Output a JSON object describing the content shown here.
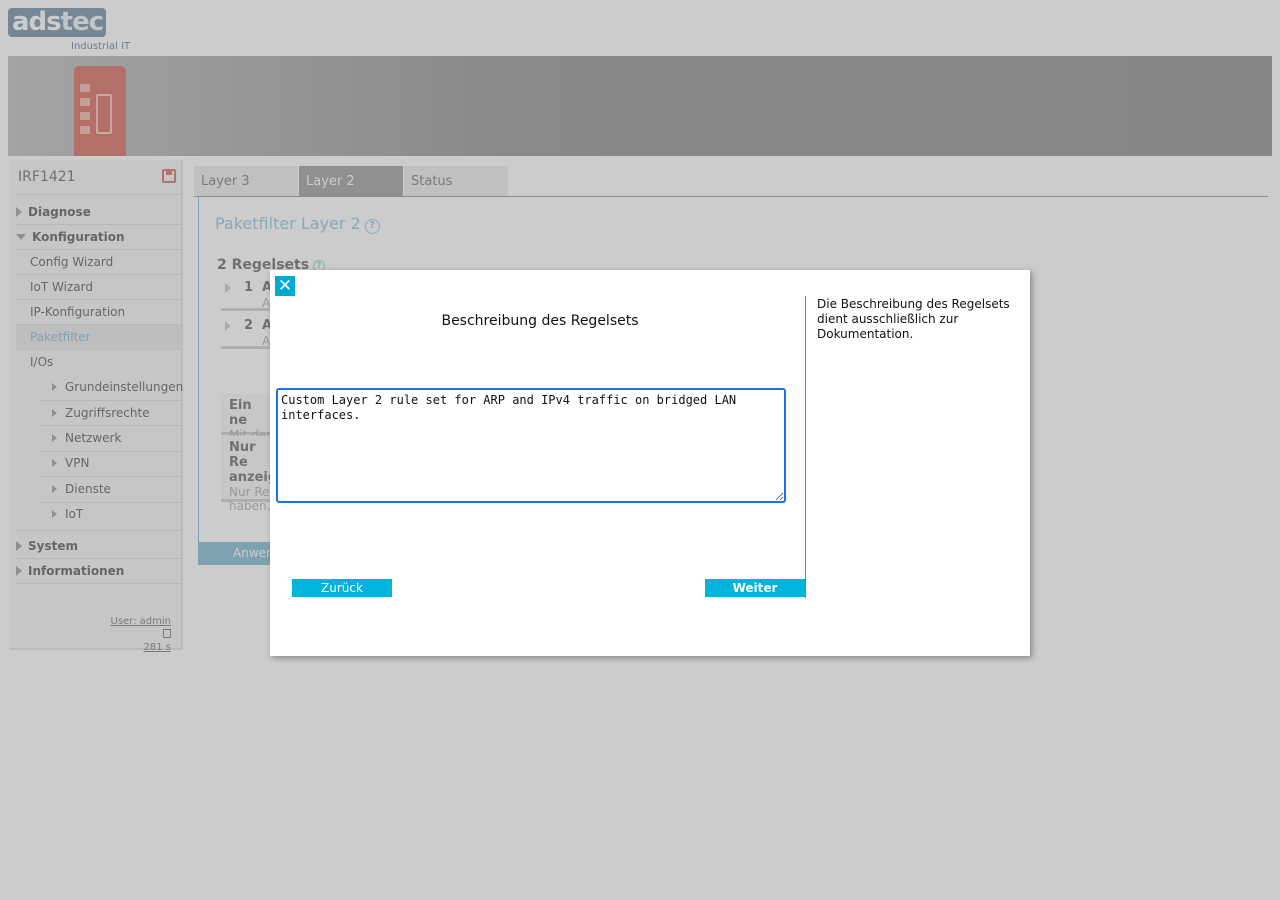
{
  "brand": {
    "logo_main": "ads",
    "logo_accent": "tec",
    "logo_subtitle": "Industrial IT"
  },
  "sidebar": {
    "device_name": "IRF1421",
    "items": [
      {
        "label": "Diagnose"
      },
      {
        "label": "Konfiguration"
      },
      {
        "label": "Config Wizard"
      },
      {
        "label": "IoT Wizard"
      },
      {
        "label": "IP-Konfiguration"
      },
      {
        "label": "Paketfilter"
      },
      {
        "label": "I/Os"
      },
      {
        "label": "Grundeinstellungen"
      },
      {
        "label": "Zugriffsrechte"
      },
      {
        "label": "Netzwerk"
      },
      {
        "label": "VPN"
      },
      {
        "label": "Dienste"
      },
      {
        "label": "IoT"
      },
      {
        "label": "System"
      },
      {
        "label": "Informationen"
      }
    ],
    "user_label": "User: admin",
    "session_time": "281 s"
  },
  "tabs": [
    {
      "label": "Layer 3"
    },
    {
      "label": "Layer 2"
    },
    {
      "label": "Status"
    }
  ],
  "main": {
    "page_title": "Paketfilter Layer 2",
    "help_glyph": "?",
    "rulesets_title": "2 Regelsets",
    "rules": [
      {
        "num": "1",
        "name": "A",
        "desc": "A"
      },
      {
        "num": "2",
        "name": "A",
        "desc": "A"
      }
    ],
    "info1_title": "Ein ne",
    "info1_text": "Mit der",
    "info2_title_l1": "Nur Re",
    "info2_title_l2": "anzeig",
    "info2_text_l1": "Nur Re",
    "info2_text_l2": "haben.",
    "apply_label": "Anwen"
  },
  "modal": {
    "close_glyph": "✕",
    "heading": "Beschreibung des Regelsets",
    "description_value": "Custom Layer 2 rule set for ARP and IPv4 traffic on bridged LAN interfaces.",
    "help_text": "Die Beschreibung des Regelsets dient ausschließlich zur Dokumentation.",
    "back_label": "Zurück",
    "next_label": "Weiter"
  },
  "colors": {
    "accent": "#00b4dc",
    "link_blue": "#7fb9d0",
    "focus_border": "#1a73e8"
  }
}
